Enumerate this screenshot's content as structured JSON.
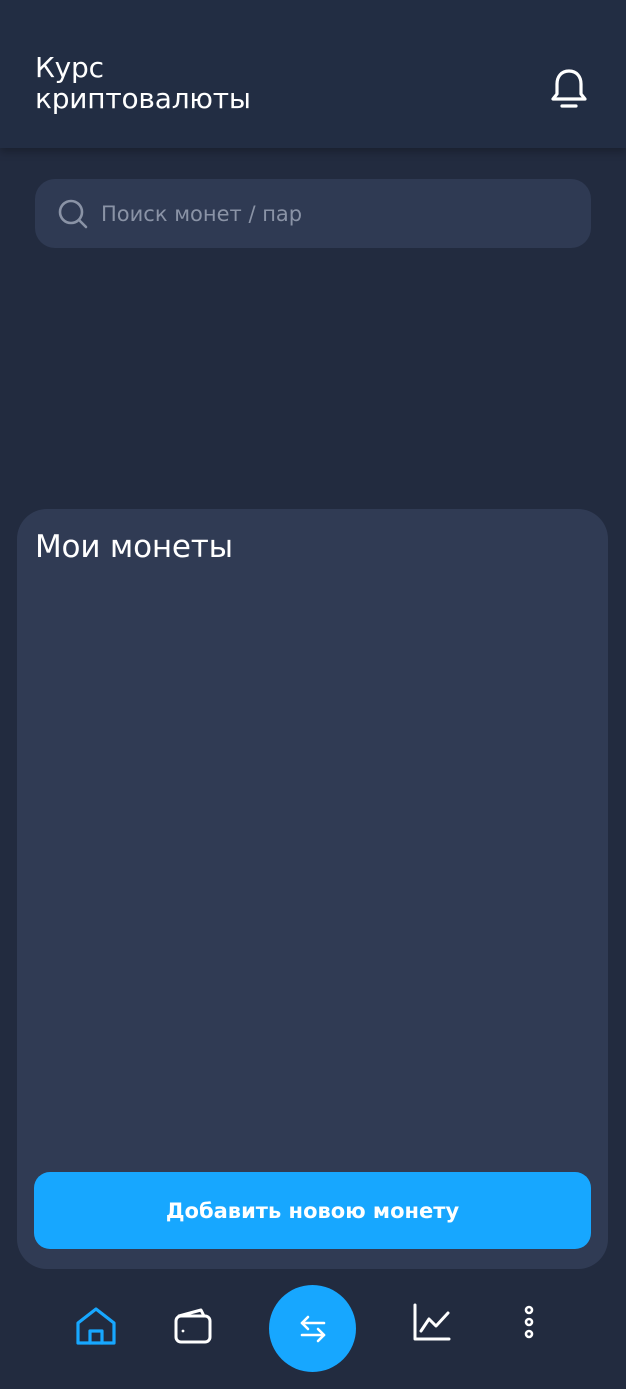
{
  "header": {
    "title": "Курс\nкриптовалюты",
    "notification_icon": "bell-icon"
  },
  "search": {
    "placeholder": "Поиск монет / пар",
    "value": "",
    "icon": "search-icon"
  },
  "my_coins": {
    "title": "Мои монеты",
    "items": [],
    "add_button_label": "Добавить новою монету"
  },
  "bottom_nav": {
    "items": [
      {
        "icon": "home-icon",
        "active": true
      },
      {
        "icon": "wallet-icon",
        "active": false
      },
      {
        "icon": "exchange-icon",
        "active": false
      },
      {
        "icon": "chart-icon",
        "active": false
      },
      {
        "icon": "more-vertical-icon",
        "active": false
      }
    ]
  },
  "colors": {
    "background": "#222b3f",
    "header": "#222d43",
    "card": "#303b54",
    "accent": "#17a7ff",
    "placeholder": "#8a93a6",
    "icon": "#ffffff"
  }
}
